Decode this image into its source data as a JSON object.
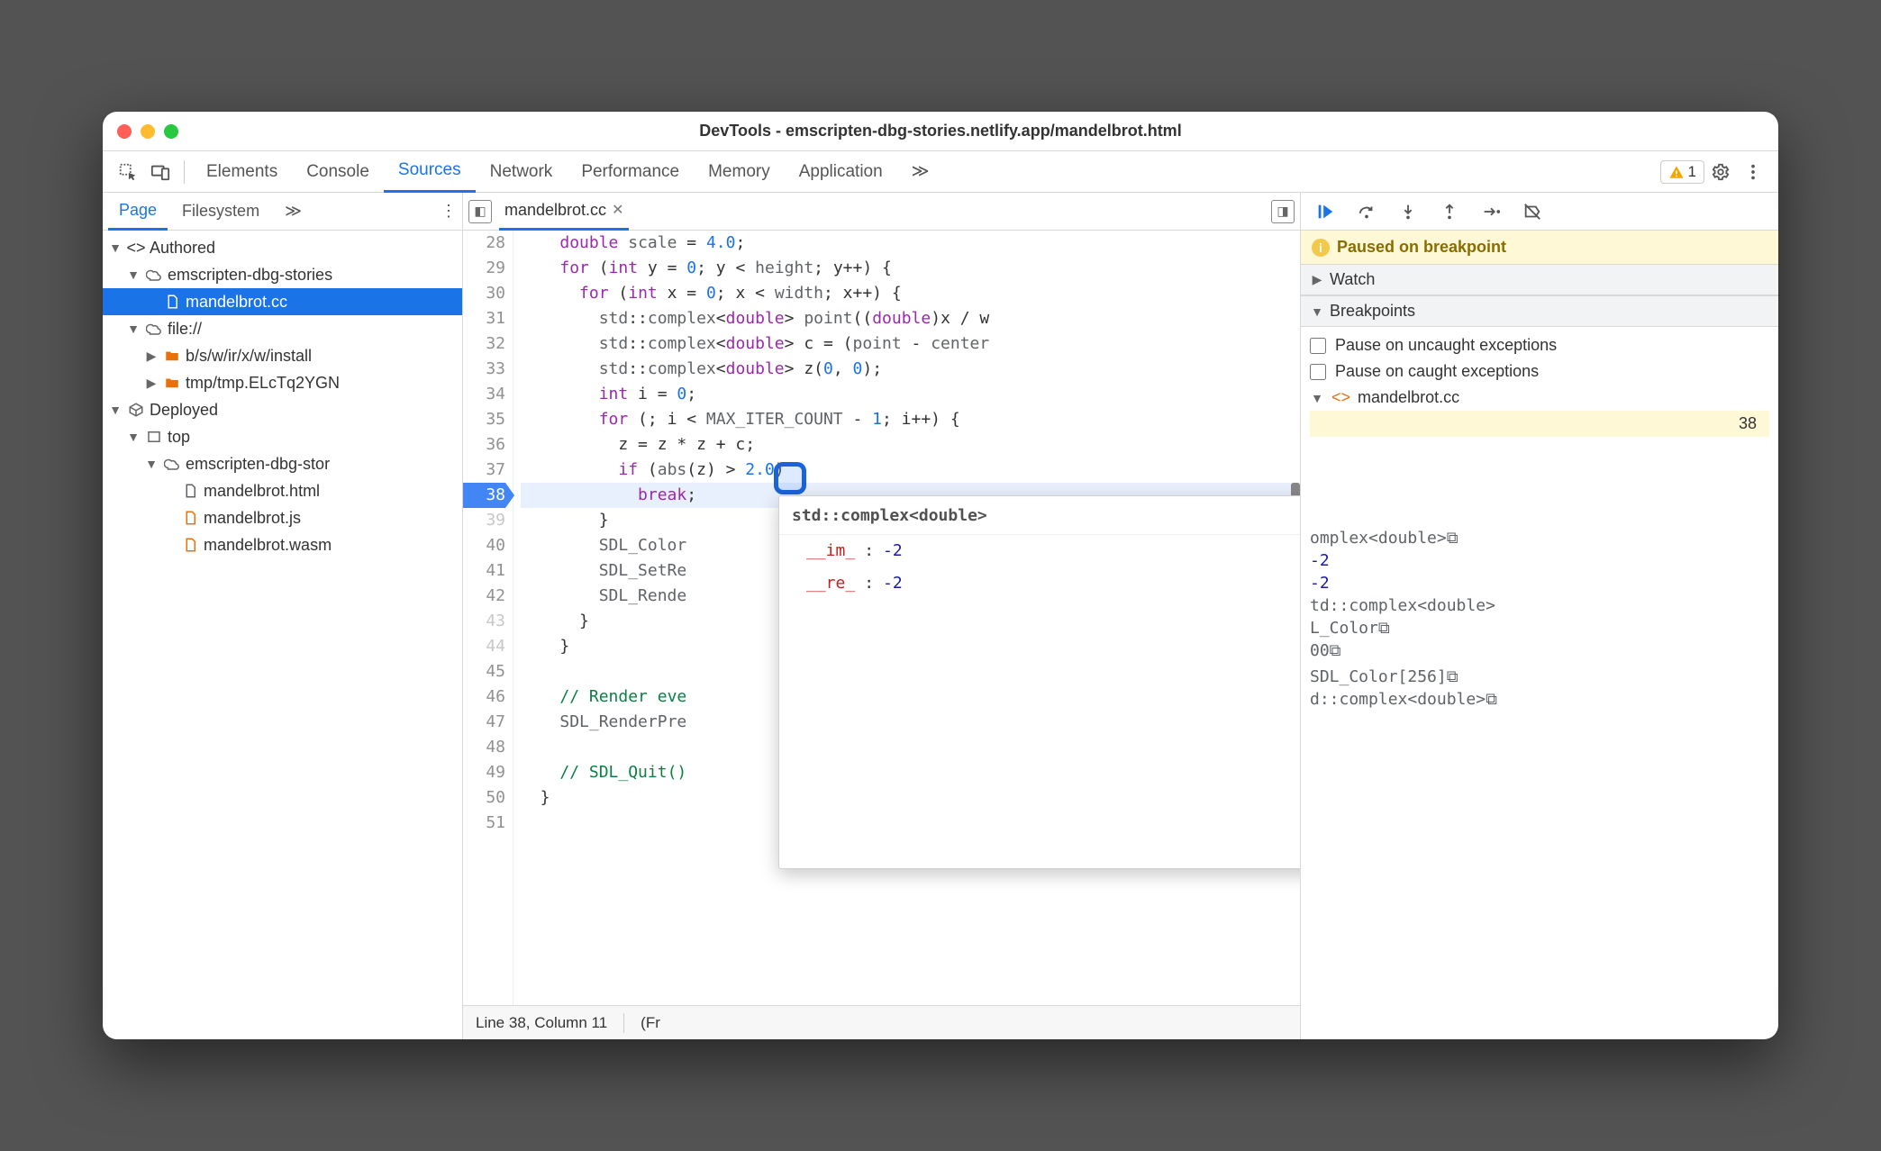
{
  "window_title": "DevTools - emscripten-dbg-stories.netlify.app/mandelbrot.html",
  "toolbar": {
    "panels": [
      "Elements",
      "Console",
      "Sources",
      "Network",
      "Performance",
      "Memory",
      "Application"
    ],
    "active": "Sources",
    "overflow": "≫",
    "warning_count": "1"
  },
  "nav": {
    "tabs": [
      "Page",
      "Filesystem"
    ],
    "active": "Page",
    "overflow": "≫",
    "tree": {
      "authored": "Authored",
      "host1": "emscripten-dbg-stories",
      "selected_file": "mandelbrot.cc",
      "file_proto": "file://",
      "install_path": "b/s/w/ir/x/w/install",
      "tmp_path": "tmp/tmp.ELcTq2YGN",
      "deployed": "Deployed",
      "top": "top",
      "host2": "emscripten-dbg-stor",
      "f_html": "mandelbrot.html",
      "f_js": "mandelbrot.js",
      "f_wasm": "mandelbrot.wasm"
    }
  },
  "editor": {
    "filename": "mandelbrot.cc",
    "first_line_no": 28,
    "current_line": 38,
    "lines": [
      "    double scale = 4.0;",
      "    for (int y = 0; y < height; y++) {",
      "      for (int x = 0; x < width; x++) {",
      "        std::complex<double> point((double)x / w",
      "        std::complex<double> c = (point - center",
      "        std::complex<double> z(0, 0);",
      "        int i = 0;",
      "        for (; i < MAX_ITER_COUNT - 1; i++) {",
      "          z = z * z + c;",
      "          if (abs(z) > 2.0)",
      "            break;",
      "        }",
      "        SDL_Color",
      "        SDL_SetRe",
      "        SDL_Rende",
      "      }",
      "    }",
      "",
      "    // Render eve",
      "    SDL_RenderPre",
      "",
      "    // SDL_Quit()",
      "  }",
      ""
    ],
    "status_left": "Line 38, Column 11",
    "status_right": "(Fr"
  },
  "hover": {
    "type": "std::complex<double>",
    "fields": [
      {
        "k": "__im_",
        "v": "-2"
      },
      {
        "k": "__re_",
        "v": "-2"
      }
    ]
  },
  "debug": {
    "paused": "Paused on breakpoint",
    "watch": "Watch",
    "breakpoints": "Breakpoints",
    "pause_uncaught": "Pause on uncaught exceptions",
    "pause_caught": "Pause on caught exceptions",
    "bp_file": "mandelbrot.cc",
    "bp_line": "38",
    "scope_items": [
      "omplex<double>⧉",
      "-2",
      "-2",
      "td::complex<double>",
      "L_Color⧉",
      "00⧉",
      "",
      "SDL_Color[256]⧉",
      "d::complex<double>⧉"
    ]
  }
}
